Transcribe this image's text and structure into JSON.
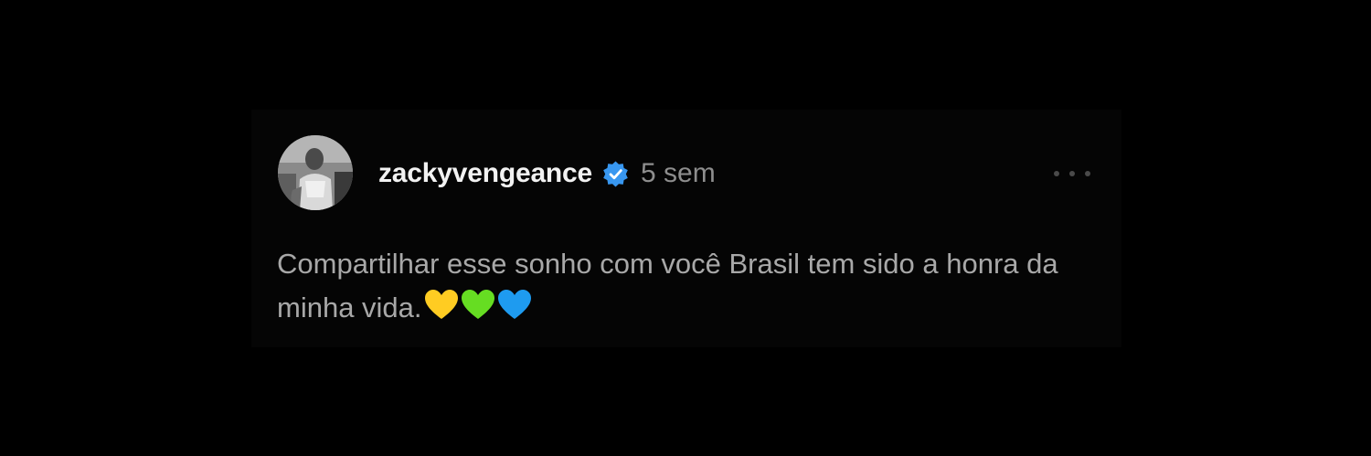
{
  "comment": {
    "username": "zackyvengeance",
    "verified": true,
    "time": "5 sem",
    "text": "Compartilhar esse sonho com você Brasil tem sido a honra da minha vida.",
    "emojis": [
      "yellow-heart",
      "green-heart",
      "blue-heart"
    ]
  },
  "colors": {
    "background": "#000000",
    "card": "#050505",
    "username": "#f2f2f2",
    "time": "#8e8e8e",
    "text": "#a8a8a8",
    "verified": "#3897f0",
    "heart_yellow": "#ffcc22",
    "heart_green": "#66dd22",
    "heart_blue": "#1e9bf0"
  },
  "icons": {
    "verified": "verified-badge-icon",
    "more": "more-horizontal-icon"
  }
}
